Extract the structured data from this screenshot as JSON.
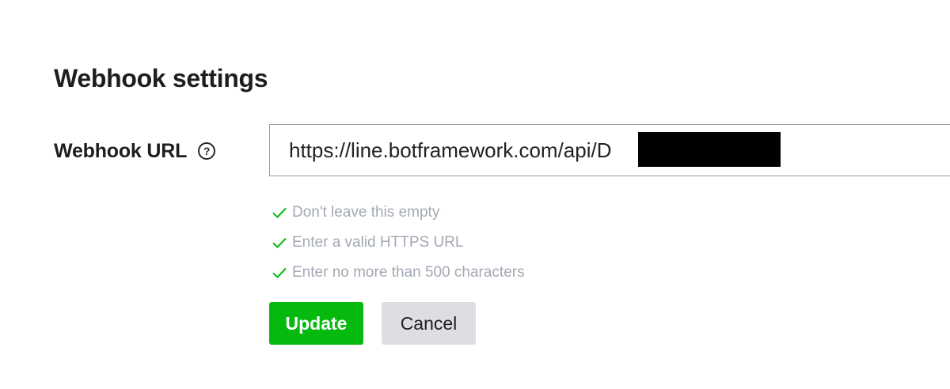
{
  "section": {
    "title": "Webhook settings"
  },
  "webhook_field": {
    "label": "Webhook URL",
    "help_icon": "question-circle-icon",
    "value": "https://line.botframework.com/api/D"
  },
  "validation": {
    "icon": "check-icon",
    "color": "#06b90e",
    "rules": [
      "Don't leave this empty",
      "Enter a valid HTTPS URL",
      "Enter no more than 500 characters"
    ]
  },
  "actions": {
    "update_label": "Update",
    "cancel_label": "Cancel",
    "primary_color": "#06b90e"
  }
}
